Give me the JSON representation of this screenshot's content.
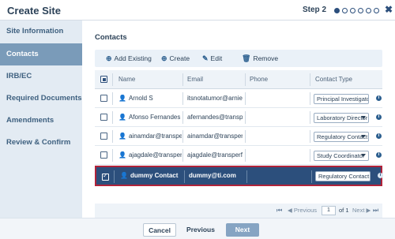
{
  "header": {
    "title": "Create Site",
    "step_label": "Step 2",
    "step_dots": [
      "active",
      "",
      "",
      "",
      "",
      ""
    ],
    "close_glyph": "✖"
  },
  "sidebar": {
    "items": [
      {
        "label": "Site Information"
      },
      {
        "label": "Contacts",
        "active": true
      },
      {
        "label": "IRB/EC"
      },
      {
        "label": "Required Documents"
      },
      {
        "label": "Amendments"
      },
      {
        "label": "Review & Confirm"
      }
    ]
  },
  "main": {
    "section_title": "Contacts",
    "toolbar": {
      "add_existing": "Add Existing",
      "create": "Create",
      "edit": "Edit",
      "remove": "Remove"
    },
    "table": {
      "columns": [
        "Name",
        "Email",
        "Phone",
        "Contact Type"
      ],
      "rows": [
        {
          "name": "Arnold S",
          "email": "itsnotatumor@arnie.com",
          "phone": "",
          "contact_type": "Principal Investigator",
          "checked": false,
          "has_caret": false
        },
        {
          "name": "Afonso Fernandes",
          "email": "afernandes@transperfect.com",
          "phone": "",
          "contact_type": "Laboratory Director",
          "checked": false,
          "has_caret": true
        },
        {
          "name": "ainamdar@transperfect.com",
          "email": "ainamdar@transperfect.com",
          "phone": "",
          "contact_type": "Regulatory Contact",
          "checked": false,
          "has_caret": true
        },
        {
          "name": "ajagdale@transperfect.com",
          "email": "ajagdale@transperfect.com",
          "phone": "",
          "contact_type": "Study Coordinator",
          "checked": false,
          "has_caret": true
        },
        {
          "name": "dummy Contact",
          "email": "dummy@ti.com",
          "phone": "",
          "contact_type": "Regulatory Contact",
          "checked": true,
          "has_caret": false,
          "selected": true
        }
      ]
    },
    "pager": {
      "previous": "Previous",
      "page_value": "1",
      "of_label": "of 1",
      "next": "Next"
    }
  },
  "footer": {
    "cancel": "Cancel",
    "previous": "Previous",
    "next": "Next"
  },
  "colors": {
    "accent": "#2c4f7c",
    "selected_border": "#b0233a",
    "sidebar_active": "#7a9bb9"
  }
}
